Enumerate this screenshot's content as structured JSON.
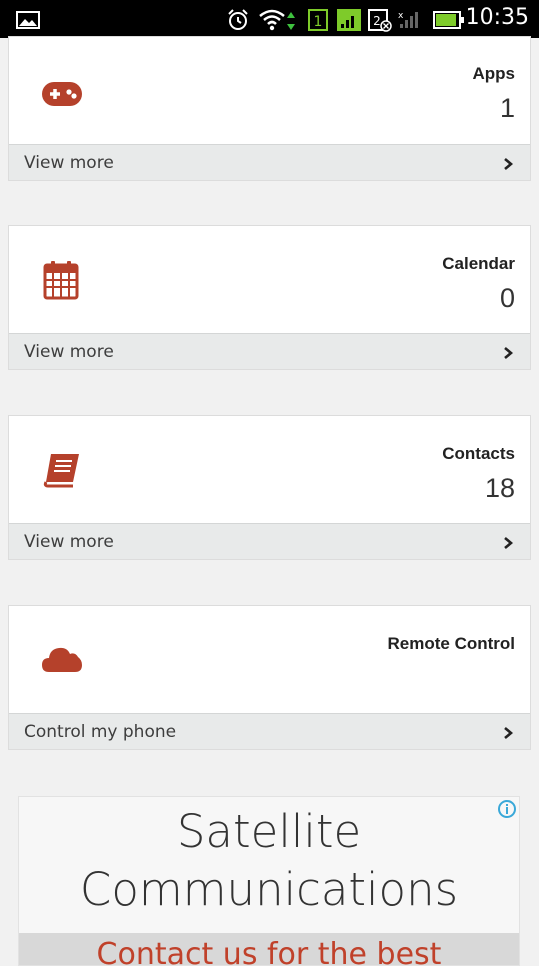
{
  "status_bar": {
    "time": "10:35",
    "icons": [
      "image-icon",
      "alarm-icon",
      "wifi-icon",
      "sim1-icon",
      "signal-icon",
      "sim2-icon",
      "battery-icon"
    ]
  },
  "colors": {
    "accent": "#b5412b",
    "card_footer": "#e8eaea",
    "background": "#f1f1f1"
  },
  "cards": [
    {
      "title": "Apps",
      "count": "1",
      "footer": "View more",
      "icon": "gamepad-icon"
    },
    {
      "title": "Calendar",
      "count": "0",
      "footer": "View more",
      "icon": "calendar-icon"
    },
    {
      "title": "Contacts",
      "count": "18",
      "footer": "View more",
      "icon": "book-icon"
    },
    {
      "title": "Remote Control",
      "count": "",
      "footer": "Control my phone",
      "icon": "cloud-icon"
    }
  ],
  "ad": {
    "headline": "Satellite Communications",
    "cta": "Contact us for the best"
  }
}
